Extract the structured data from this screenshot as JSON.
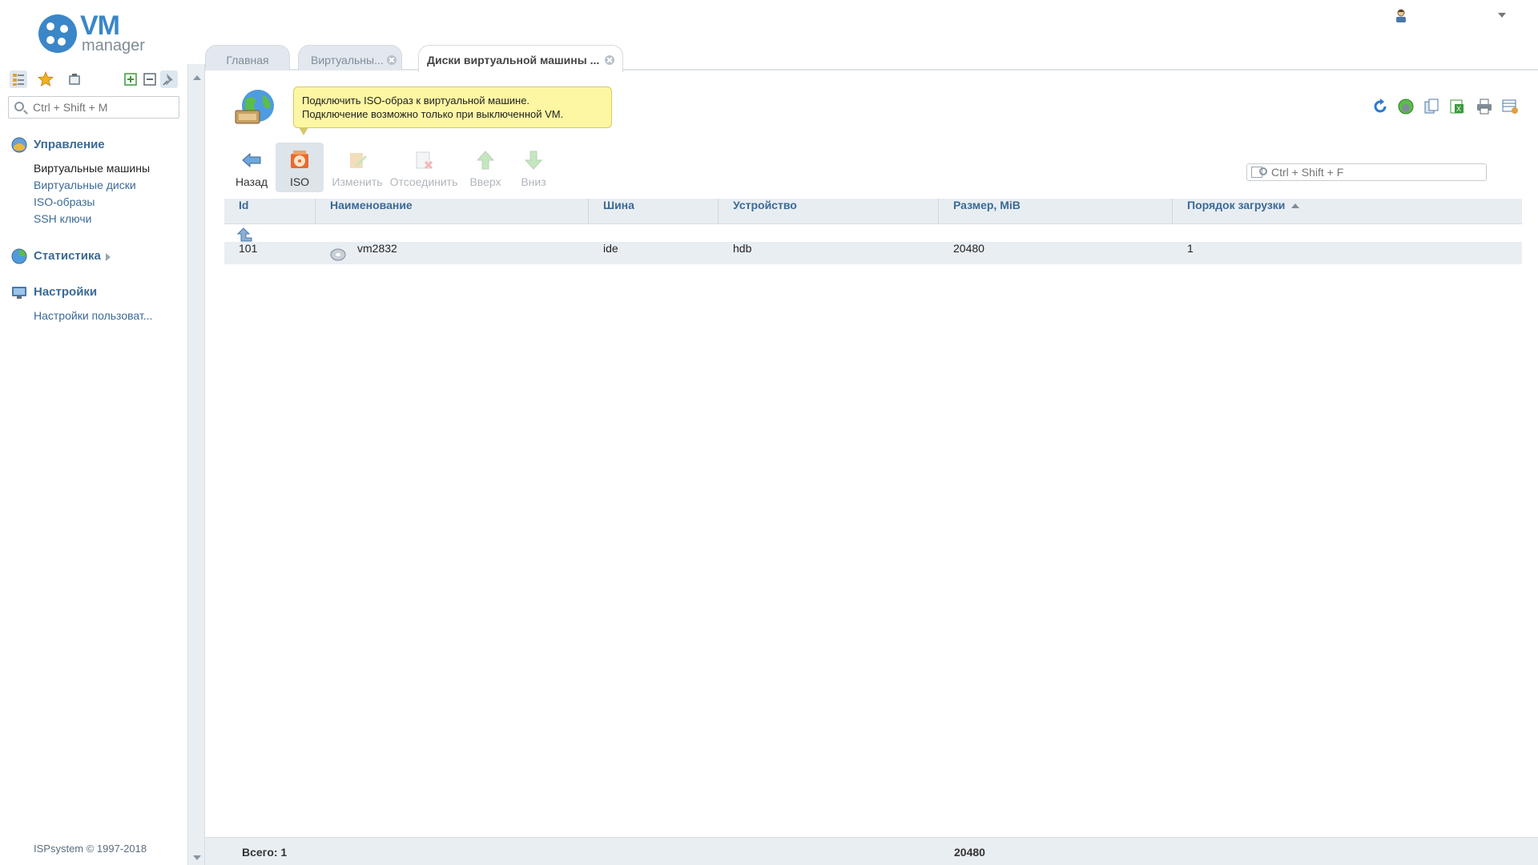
{
  "app": {
    "logo_main": "VM",
    "logo_sub": "manager"
  },
  "sidebar": {
    "search_placeholder": "Ctrl + Shift + M",
    "sections": [
      {
        "title": "Управление",
        "items": [
          "Виртуальные машины",
          "Виртуальные диски",
          "ISO-образы",
          "SSH ключи"
        ]
      },
      {
        "title": "Статистика",
        "items": []
      },
      {
        "title": "Настройки",
        "items": [
          "Настройки пользоват..."
        ]
      }
    ],
    "active_item": "Виртуальные машины",
    "copyright": "ISPsystem © 1997-2018"
  },
  "tabs": [
    {
      "label": "Главная"
    },
    {
      "label": "Виртуальны..."
    },
    {
      "label": "Диски виртуальной машины ..."
    }
  ],
  "tooltip": {
    "line1": "Подключить ISO-образ к виртуальной машине.",
    "line2": "Подключение возможно только при выключенной VM."
  },
  "toolbar": {
    "buttons": [
      {
        "label": "Назад",
        "icon": "back-arrow-icon",
        "state": "enabled"
      },
      {
        "label": "ISO",
        "icon": "iso-disc-icon",
        "state": "active"
      },
      {
        "label": "Изменить",
        "icon": "edit-icon",
        "state": "disabled"
      },
      {
        "label": "Отсоединить",
        "icon": "detach-icon",
        "state": "disabled"
      },
      {
        "label": "Вверх",
        "icon": "arrow-up-icon",
        "state": "disabled"
      },
      {
        "label": "Вниз",
        "icon": "arrow-down-icon",
        "state": "disabled"
      }
    ]
  },
  "filter": {
    "placeholder": "Ctrl + Shift + F"
  },
  "table": {
    "columns": [
      "Id",
      "Наименование",
      "Шина",
      "Устройство",
      "Размер, MiB",
      "Порядок загрузки"
    ],
    "sorted_column": "Порядок загрузки",
    "sort_direction": "ascending",
    "rows": [
      {
        "id": "101",
        "name": "vm2832",
        "bus": "ide",
        "device": "hdb",
        "size": "20480",
        "boot_order": "1"
      }
    ]
  },
  "footer": {
    "total_label": "Всего: 1",
    "size_sum": "20480"
  },
  "colors": {
    "accent": "#3a86c8",
    "link": "#3b6a95",
    "tooltip_bg": "#fdf7a4",
    "header_bg": "#e8edf2"
  }
}
